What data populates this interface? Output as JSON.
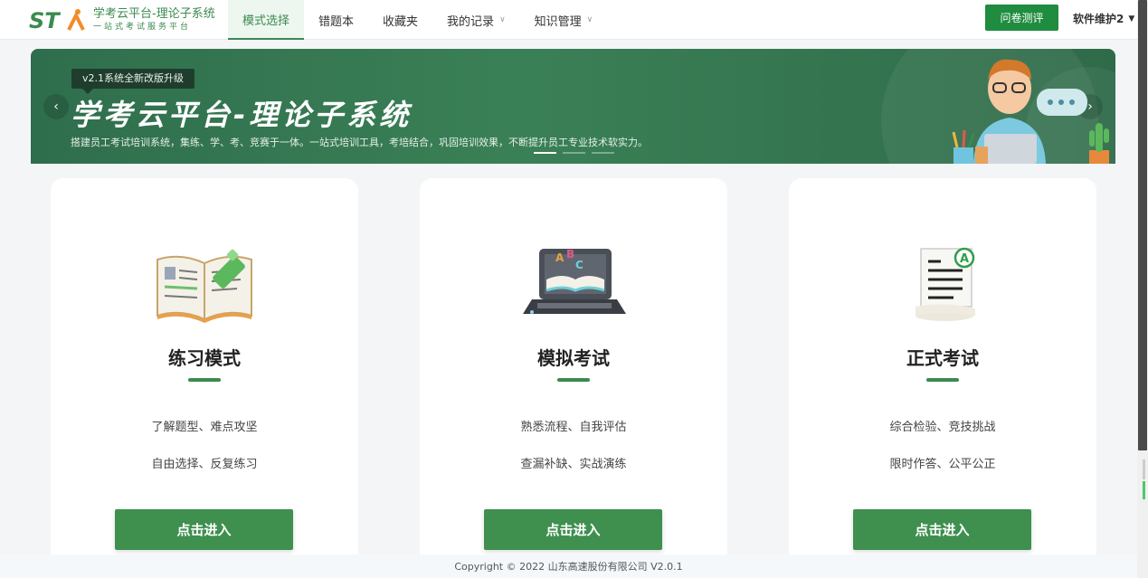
{
  "header": {
    "logo_mark": "STA",
    "logo_title": "学考云平台-理论子系统",
    "logo_subtitle": "一站式考试服务平台",
    "nav": [
      {
        "label": "模式选择",
        "active": true,
        "dropdown": false
      },
      {
        "label": "错题本",
        "active": false,
        "dropdown": false
      },
      {
        "label": "收藏夹",
        "active": false,
        "dropdown": false
      },
      {
        "label": "我的记录",
        "active": false,
        "dropdown": true
      },
      {
        "label": "知识管理",
        "active": false,
        "dropdown": true
      }
    ],
    "survey_button": "问卷测评",
    "user_name": "软件维护2"
  },
  "banner": {
    "version_tag": "v2.1系统全新改版升级",
    "title": "学考云平台-理论子系统",
    "subtitle": "搭建员工考试培训系统，集练、学、考、竞赛于一体。一站式培训工具，考培结合，巩固培训效果，不断提升员工专业技术软实力。",
    "prev_icon": "chevron-left-icon",
    "next_icon": "chevron-right-icon",
    "active_slide": 1,
    "slide_count": 3
  },
  "cards": [
    {
      "title": "练习模式",
      "line1": "了解题型、难点攻坚",
      "line2": "自由选择、反复练习",
      "button": "点击进入",
      "icon": "open-book-icon"
    },
    {
      "title": "模拟考试",
      "line1": "熟悉流程、自我评估",
      "line2": "查漏补缺、实战演练",
      "button": "点击进入",
      "icon": "laptop-book-icon"
    },
    {
      "title": "正式考试",
      "line1": "综合检验、竞技挑战",
      "line2": "限时作答、公平公正",
      "button": "点击进入",
      "icon": "exam-paper-icon"
    }
  ],
  "footer": {
    "copyright": "Copyright © 2022 山东高速股份有限公司 V2.0.1"
  },
  "colors": {
    "brand_green": "#3b8a4f",
    "survey_button": "#1f8c3f",
    "banner_bg": "#2f6e4d"
  }
}
